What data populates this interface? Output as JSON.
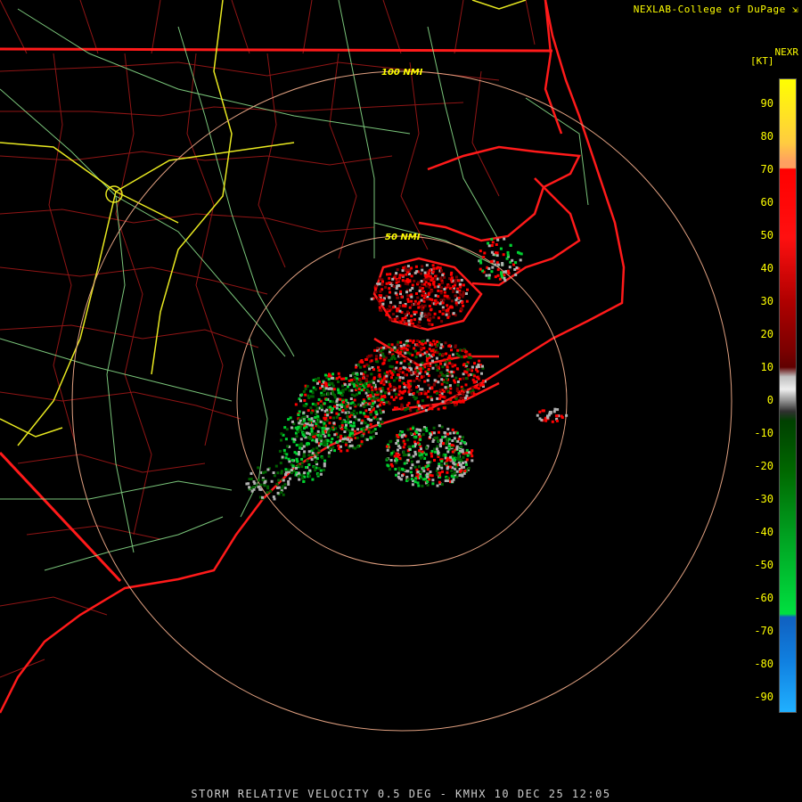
{
  "credit": "NEXLAB-College of DuPage",
  "credit_icon": "link-arrow-icon",
  "product": "NEXR",
  "units": "[KT]",
  "ring_labels": [
    "100 NMI",
    "50 NMI"
  ],
  "legend_ticks": [
    "90",
    "80",
    "70",
    "60",
    "50",
    "40",
    "30",
    "20",
    "10",
    "0",
    "-10",
    "-20",
    "-30",
    "-40",
    "-50",
    "-60",
    "-70",
    "-80",
    "-90"
  ],
  "legend_colors": {
    "yellow": "#ffff00",
    "orange": "#ffa060",
    "red": "#ff0000",
    "dark_red": "#7a0000",
    "gray": "#b0b0b0",
    "dark_green": "#006000",
    "green": "#00d030",
    "blue": "#1060c0",
    "light_blue": "#20b0ff"
  },
  "map_colors": {
    "coast": "#ff1a1a",
    "counties": "#b01818",
    "highways": "#9ee89e",
    "interstates": "#e8e820",
    "rings": "#e0a080"
  },
  "footer": "STORM RELATIVE VELOCITY 0.5 DEG - KMHX 10 DEC 25 12:05"
}
